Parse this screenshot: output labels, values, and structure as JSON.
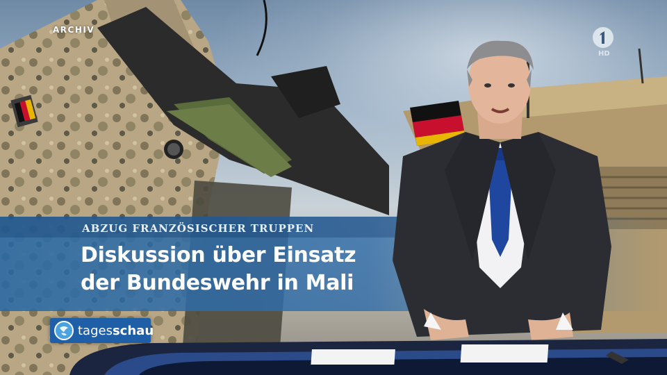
{
  "overlay": {
    "archive_label": "ARCHIV",
    "channel_hd": "HD"
  },
  "lower_third": {
    "topline": "ABZUG FRANZÖSISCHER TRUPPEN",
    "headline_line1": "Diskussion über Einsatz",
    "headline_line2": "der Bundeswehr in Mali"
  },
  "brand": {
    "name_regular": "tages",
    "name_bold": "schau",
    "badge_color": "#1f5fa8"
  },
  "colors": {
    "lowerthird_blue": "#2869a5",
    "suit": "#2b2d33",
    "tie": "#1f47a0"
  }
}
